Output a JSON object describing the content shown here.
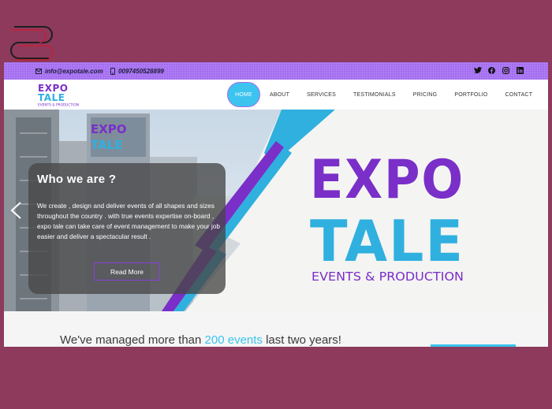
{
  "topbar": {
    "email": "info@expotale.com",
    "phone": "0097450528899",
    "socials": [
      "twitter-icon",
      "facebook-icon",
      "instagram-icon",
      "linkedin-icon"
    ]
  },
  "brand": {
    "line1": "EXPO",
    "line2": "TALE",
    "tagline": "EVENTS & PRODUCTION"
  },
  "nav": {
    "items": [
      "HOME",
      "ABOUT",
      "SERVICES",
      "TESTIMONIALS",
      "PRICING",
      "PORTFOLIO",
      "CONTACT"
    ],
    "active": "HOME"
  },
  "hero": {
    "card_title": "Who we are ?",
    "card_text": "We create , design and deliver events of all shapes and sizes throughout the country . with true events expertise on-board , expo tale can take care of event management to make your job easier and deliver a spectacular result .",
    "button": "Read More"
  },
  "band": {
    "headline_pre": "We've managed more than",
    "headline_highlight": "200 events",
    "headline_post": "last two years!"
  },
  "colors": {
    "background": "#8e3a5c",
    "topbar": "#a36cf0",
    "accent_blue": "#3cc4ee",
    "accent_purple": "#7a2fc8"
  }
}
